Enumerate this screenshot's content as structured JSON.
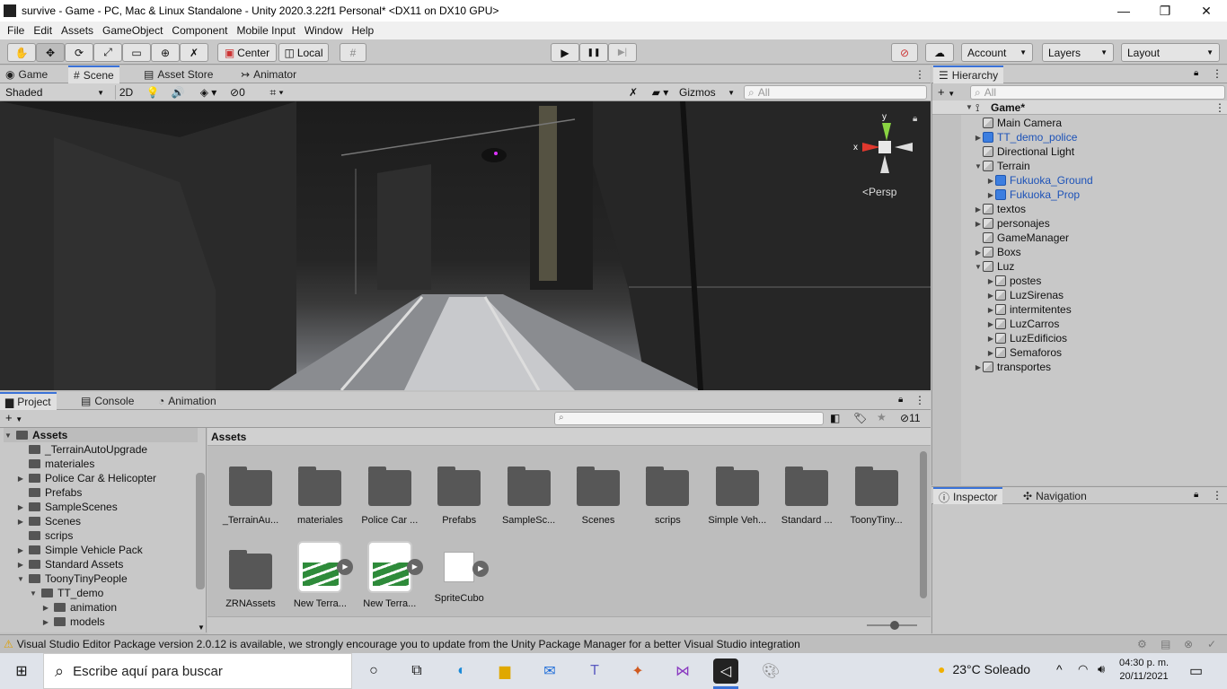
{
  "window": {
    "title": "survive - Game - PC, Mac & Linux Standalone - Unity 2020.3.22f1 Personal* <DX11 on DX10 GPU>",
    "minimize": "—",
    "restore": "❐",
    "close": "✕"
  },
  "menu": [
    "File",
    "Edit",
    "Assets",
    "GameObject",
    "Component",
    "Mobile Input",
    "Window",
    "Help"
  ],
  "toolbar": {
    "pivot": "Center",
    "space": "Local",
    "play": "▶",
    "pause": "❚❚",
    "step": "▶|",
    "account": "Account",
    "layers": "Layers",
    "layout": "Layout"
  },
  "scene_tabs": [
    "Game",
    "Scene",
    "Asset Store",
    "Animator"
  ],
  "scene_toolbar": {
    "shading": "Shaded",
    "mode2d": "2D",
    "hidden_count": "0",
    "gizmos": "Gizmos",
    "search_placeholder": "All",
    "persp": "Persp",
    "axis_x": "x",
    "axis_y": "y"
  },
  "hierarchy": {
    "title": "Hierarchy",
    "search_placeholder": "All",
    "scene": "Game*",
    "items": [
      {
        "label": "Main Camera",
        "depth": 1,
        "arrow": "",
        "prefab": false
      },
      {
        "label": "TT_demo_police",
        "depth": 1,
        "arrow": "▶",
        "prefab": true
      },
      {
        "label": "Directional Light",
        "depth": 1,
        "arrow": "",
        "prefab": false
      },
      {
        "label": "Terrain",
        "depth": 1,
        "arrow": "▼",
        "prefab": false
      },
      {
        "label": "Fukuoka_Ground",
        "depth": 2,
        "arrow": "▶",
        "prefab": true
      },
      {
        "label": "Fukuoka_Prop",
        "depth": 2,
        "arrow": "▶",
        "prefab": true
      },
      {
        "label": "textos",
        "depth": 1,
        "arrow": "▶",
        "prefab": false
      },
      {
        "label": "personajes",
        "depth": 1,
        "arrow": "▶",
        "prefab": false
      },
      {
        "label": "GameManager",
        "depth": 1,
        "arrow": "",
        "prefab": false
      },
      {
        "label": "Boxs",
        "depth": 1,
        "arrow": "▶",
        "prefab": false
      },
      {
        "label": "Luz",
        "depth": 1,
        "arrow": "▼",
        "prefab": false
      },
      {
        "label": "postes",
        "depth": 2,
        "arrow": "▶",
        "prefab": false
      },
      {
        "label": "LuzSirenas",
        "depth": 2,
        "arrow": "▶",
        "prefab": false
      },
      {
        "label": "intermitentes",
        "depth": 2,
        "arrow": "▶",
        "prefab": false
      },
      {
        "label": "LuzCarros",
        "depth": 2,
        "arrow": "▶",
        "prefab": false
      },
      {
        "label": "LuzEdificios",
        "depth": 2,
        "arrow": "▶",
        "prefab": false
      },
      {
        "label": "Semaforos",
        "depth": 2,
        "arrow": "▶",
        "prefab": false
      },
      {
        "label": "transportes",
        "depth": 1,
        "arrow": "▶",
        "prefab": false
      }
    ]
  },
  "inspector_tabs": [
    "Inspector",
    "Navigation"
  ],
  "project_tabs": [
    "Project",
    "Console",
    "Animation"
  ],
  "project": {
    "hidden_count": "11",
    "breadcrumb": "Assets",
    "tree": [
      {
        "label": "Assets",
        "depth": 0,
        "arrow": "▼"
      },
      {
        "label": "_TerrainAutoUpgrade",
        "depth": 1,
        "arrow": ""
      },
      {
        "label": "materiales",
        "depth": 1,
        "arrow": ""
      },
      {
        "label": "Police Car & Helicopter",
        "depth": 1,
        "arrow": "▶"
      },
      {
        "label": "Prefabs",
        "depth": 1,
        "arrow": ""
      },
      {
        "label": "SampleScenes",
        "depth": 1,
        "arrow": "▶"
      },
      {
        "label": "Scenes",
        "depth": 1,
        "arrow": "▶"
      },
      {
        "label": "scrips",
        "depth": 1,
        "arrow": ""
      },
      {
        "label": "Simple Vehicle Pack",
        "depth": 1,
        "arrow": "▶"
      },
      {
        "label": "Standard Assets",
        "depth": 1,
        "arrow": "▶"
      },
      {
        "label": "ToonyTinyPeople",
        "depth": 1,
        "arrow": "▼"
      },
      {
        "label": "TT_demo",
        "depth": 2,
        "arrow": "▼"
      },
      {
        "label": "animation",
        "depth": 3,
        "arrow": "▶"
      },
      {
        "label": "models",
        "depth": 3,
        "arrow": "▶"
      }
    ],
    "grid_row1": [
      "_TerrainAu...",
      "materiales",
      "Police Car ...",
      "Prefabs",
      "SampleSc...",
      "Scenes",
      "scrips",
      "Simple Veh...",
      "Standard ...",
      "ToonyTiny..."
    ],
    "grid_row2": [
      {
        "label": "ZRNAssets",
        "kind": "folder"
      },
      {
        "label": "New Terra...",
        "kind": "terrain"
      },
      {
        "label": "New Terra...",
        "kind": "terrain"
      },
      {
        "label": "SpriteCubo",
        "kind": "sprite"
      }
    ]
  },
  "status": {
    "message": "Visual Studio Editor Package version 2.0.12 is available, we strongly encourage you to update from the Unity Package Manager for a better Visual Studio integration"
  },
  "taskbar": {
    "search_placeholder": "Escribe aquí para buscar",
    "weather": "23°C  Soleado",
    "time": "04:30 p. m.",
    "date": "20/11/2021"
  }
}
